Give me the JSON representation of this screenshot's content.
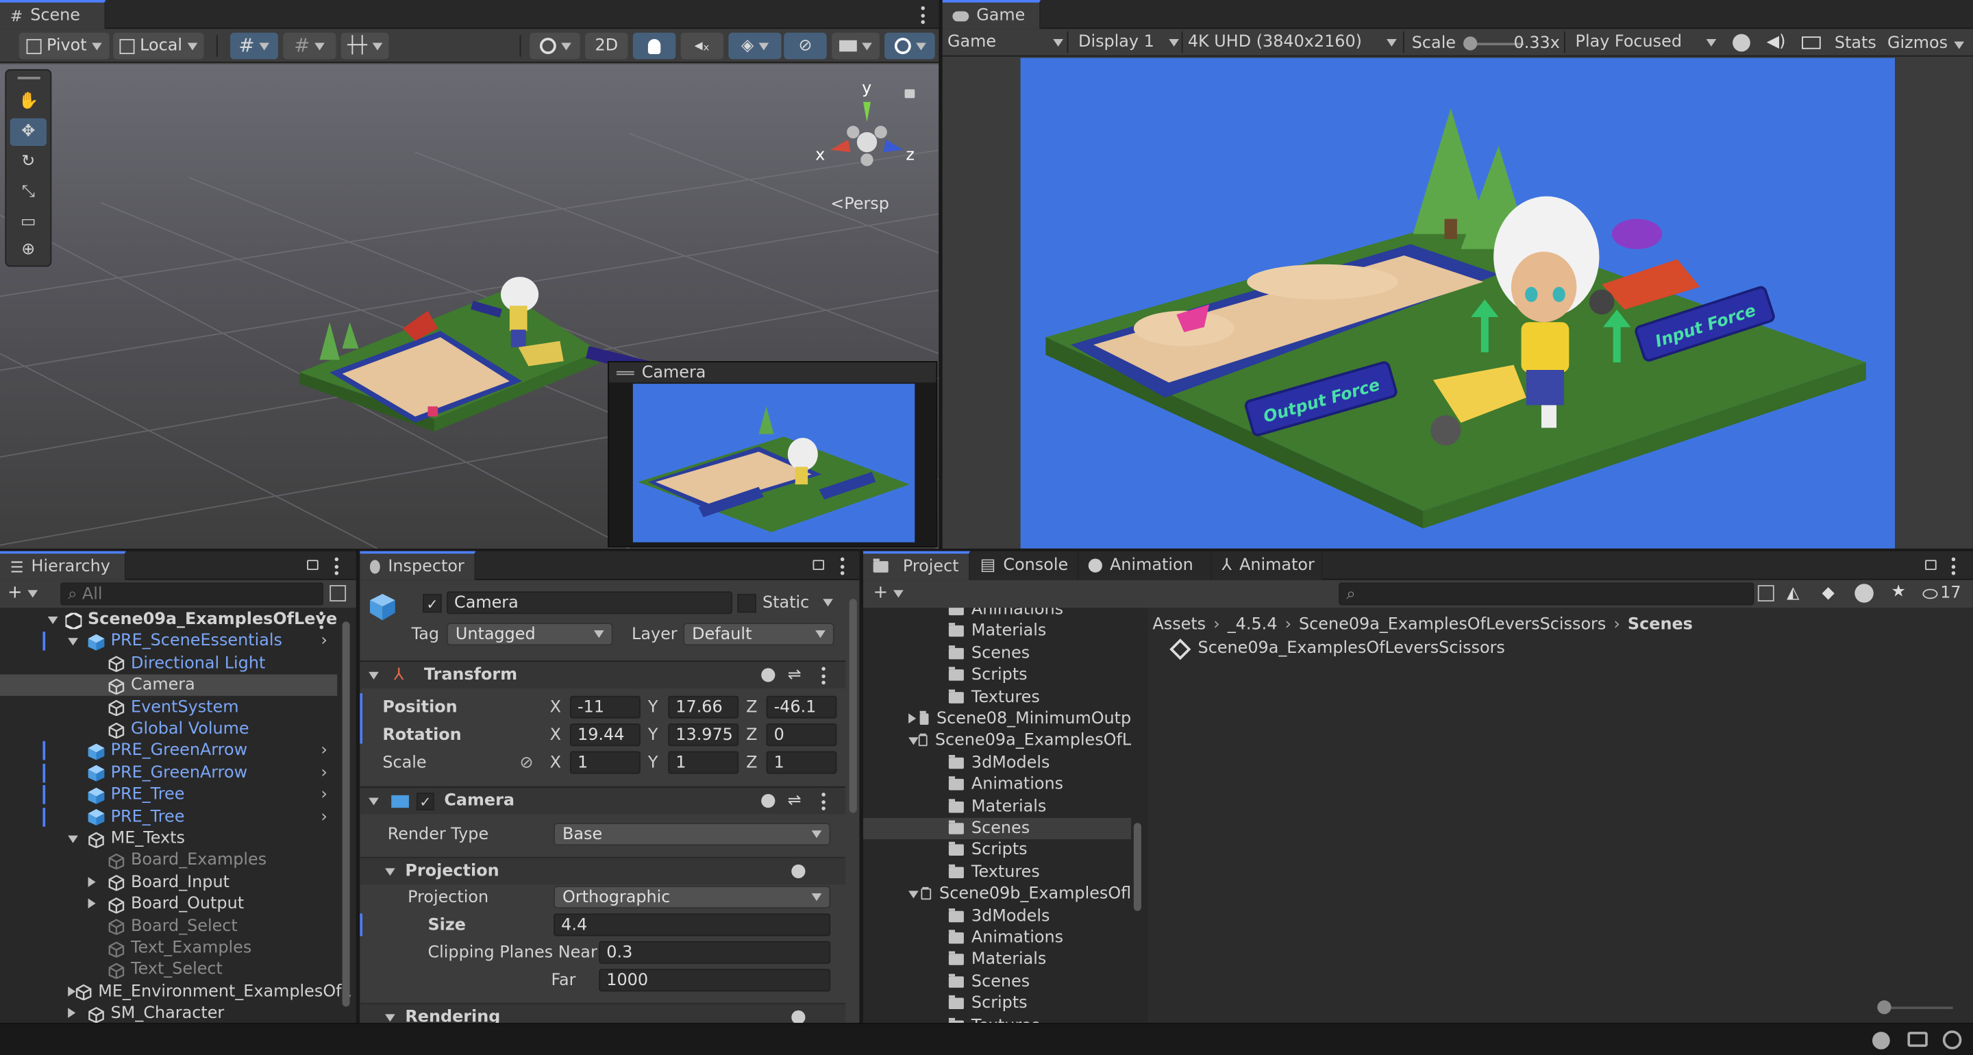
{
  "scene": {
    "tab": "Scene",
    "pivot": "Pivot",
    "local": "Local",
    "mode2d": "2D",
    "persp": "Persp",
    "axis_x": "x",
    "axis_y": "y",
    "axis_z": "z",
    "camera_preview_title": "Camera"
  },
  "game": {
    "tab": "Game",
    "view": "Game",
    "display": "Display 1",
    "resolution": "4K UHD (3840x2160)",
    "scale_label": "Scale",
    "scale_value": "0.33x",
    "play_mode": "Play Focused",
    "stats": "Stats",
    "gizmos": "Gizmos",
    "sign_left": "Output Force",
    "sign_right": "Input Force",
    "background": "#3f74e0"
  },
  "hierarchy": {
    "tab": "Hierarchy",
    "search_placeholder": "All",
    "items": [
      {
        "label": "Scene09a_ExamplesOfLeve",
        "depth": 0,
        "kind": "scene",
        "expand": "down",
        "style": "bold"
      },
      {
        "label": "PRE_SceneEssentials",
        "depth": 1,
        "kind": "prefab",
        "expand": "down",
        "style": "blue",
        "arrow": true
      },
      {
        "label": "Directional Light",
        "depth": 2,
        "kind": "go",
        "style": "blue"
      },
      {
        "label": "Camera",
        "depth": 2,
        "kind": "go",
        "style": "normal",
        "selected": true
      },
      {
        "label": "EventSystem",
        "depth": 2,
        "kind": "go",
        "style": "blue"
      },
      {
        "label": "Global Volume",
        "depth": 2,
        "kind": "go",
        "style": "blue"
      },
      {
        "label": "PRE_GreenArrow",
        "depth": 1,
        "kind": "prefab",
        "style": "blue",
        "arrow": true
      },
      {
        "label": "PRE_GreenArrow",
        "depth": 1,
        "kind": "prefab",
        "style": "blue",
        "arrow": true
      },
      {
        "label": "PRE_Tree",
        "depth": 1,
        "kind": "prefab",
        "style": "blue",
        "arrow": true
      },
      {
        "label": "PRE_Tree",
        "depth": 1,
        "kind": "prefab",
        "style": "blue",
        "arrow": true
      },
      {
        "label": "ME_Texts",
        "depth": 1,
        "kind": "go",
        "expand": "down",
        "style": "normal"
      },
      {
        "label": "Board_Examples",
        "depth": 2,
        "kind": "go",
        "style": "grey"
      },
      {
        "label": "Board_Input",
        "depth": 2,
        "kind": "go",
        "expand": "right",
        "style": "normal"
      },
      {
        "label": "Board_Output",
        "depth": 2,
        "kind": "go",
        "expand": "right",
        "style": "normal"
      },
      {
        "label": "Board_Select",
        "depth": 2,
        "kind": "go",
        "style": "grey"
      },
      {
        "label": "Text_Examples",
        "depth": 2,
        "kind": "go",
        "style": "grey"
      },
      {
        "label": "Text_Select",
        "depth": 2,
        "kind": "go",
        "style": "grey"
      },
      {
        "label": "ME_Environment_ExamplesOfL",
        "depth": 1,
        "kind": "go",
        "expand": "right",
        "style": "normal"
      },
      {
        "label": "SM_Character",
        "depth": 1,
        "kind": "go",
        "expand": "right",
        "style": "normal"
      }
    ]
  },
  "inspector": {
    "tab": "Inspector",
    "name": "Camera",
    "static": "Static",
    "tag_label": "Tag",
    "tag": "Untagged",
    "layer_label": "Layer",
    "layer": "Default",
    "transform": {
      "title": "Transform",
      "position": "Position",
      "rotation": "Rotation",
      "scale": "Scale",
      "px": "-11",
      "py": "17.66",
      "pz": "-46.1",
      "rx": "19.44",
      "ry": "13.975",
      "rz": "0",
      "sx": "1",
      "sy": "1",
      "sz": "1",
      "X": "X",
      "Y": "Y",
      "Z": "Z"
    },
    "camera": {
      "title": "Camera",
      "render_type_label": "Render Type",
      "render_type": "Base",
      "projection_section": "Projection",
      "projection_label": "Projection",
      "projection": "Orthographic",
      "size_label": "Size",
      "size": "4.4",
      "clip_label": "Clipping Planes Near",
      "near": "0.3",
      "far_label": "Far",
      "far": "1000",
      "rendering": "Rendering"
    }
  },
  "project": {
    "tabs": [
      "Project",
      "Console",
      "Animation",
      "Animator"
    ],
    "count": "17",
    "breadcrumb": [
      "Assets",
      "_4.5.4",
      "Scene09a_ExamplesOfLeversScissors",
      "Scenes"
    ],
    "asset": "Scene09a_ExamplesOfLeversScissors",
    "tree": [
      {
        "label": "Animations",
        "depth": 2
      },
      {
        "label": "Materials",
        "depth": 2
      },
      {
        "label": "Scenes",
        "depth": 2
      },
      {
        "label": "Scripts",
        "depth": 2
      },
      {
        "label": "Textures",
        "depth": 2
      },
      {
        "label": "Scene08_MinimumOutp",
        "depth": 1,
        "expand": "right"
      },
      {
        "label": "Scene09a_ExamplesOfL",
        "depth": 1,
        "expand": "down",
        "open": true
      },
      {
        "label": "3dModels",
        "depth": 2
      },
      {
        "label": "Animations",
        "depth": 2
      },
      {
        "label": "Materials",
        "depth": 2
      },
      {
        "label": "Scenes",
        "depth": 2,
        "selected": true
      },
      {
        "label": "Scripts",
        "depth": 2
      },
      {
        "label": "Textures",
        "depth": 2
      },
      {
        "label": "Scene09b_ExamplesOfl",
        "depth": 1,
        "expand": "down",
        "open": true
      },
      {
        "label": "3dModels",
        "depth": 2
      },
      {
        "label": "Animations",
        "depth": 2
      },
      {
        "label": "Materials",
        "depth": 2
      },
      {
        "label": "Scenes",
        "depth": 2
      },
      {
        "label": "Scripts",
        "depth": 2
      },
      {
        "label": "Textures",
        "depth": 2
      }
    ]
  }
}
